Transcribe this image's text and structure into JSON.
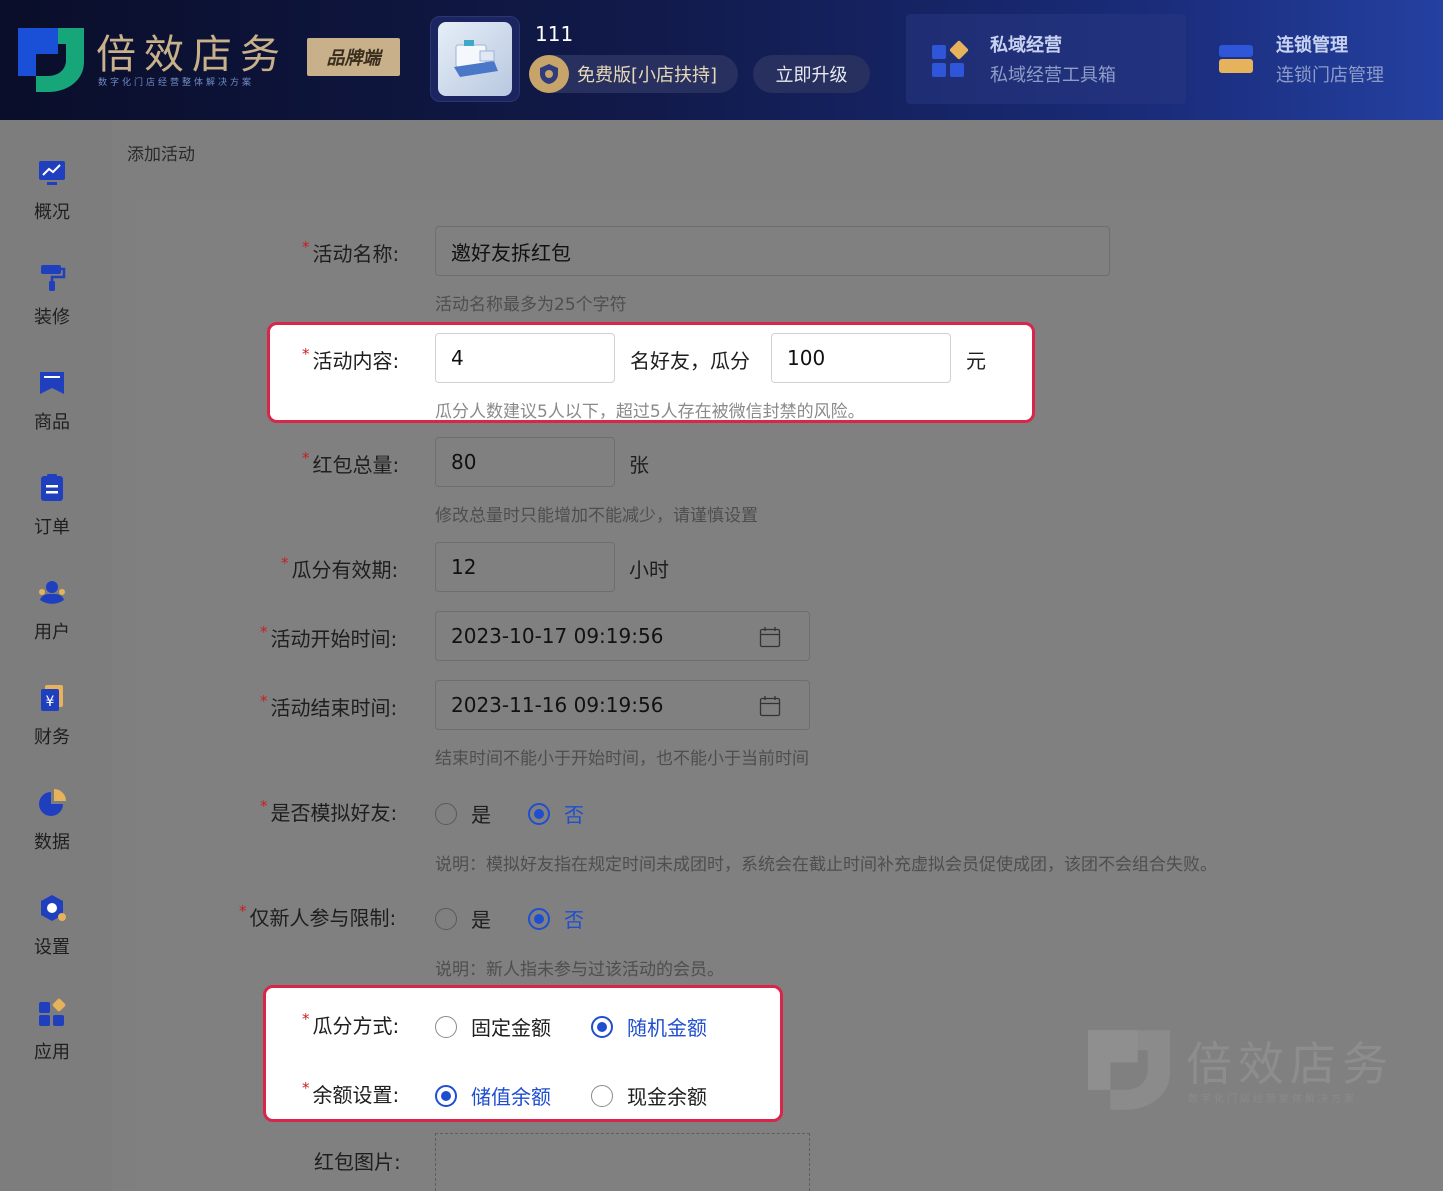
{
  "header": {
    "logo_text": "倍效店务",
    "logo_sub": "数字化门店经营整体解决方案",
    "brand_badge": "品牌端",
    "store_name": "111",
    "plan_label": "免费版[小店扶持]",
    "upgrade_label": "立即升级",
    "tools": [
      {
        "title": "私域经营",
        "subtitle": "私域经营工具箱",
        "icon": "grid-diamond-icon"
      },
      {
        "title": "连锁管理",
        "subtitle": "连锁门店管理",
        "icon": "store-icon"
      }
    ]
  },
  "sidebar": {
    "items": [
      {
        "label": "概况",
        "icon": "chart-monitor-icon"
      },
      {
        "label": "装修",
        "icon": "paint-roller-icon"
      },
      {
        "label": "商品",
        "icon": "product-tag-icon"
      },
      {
        "label": "订单",
        "icon": "clipboard-icon"
      },
      {
        "label": "用户",
        "icon": "users-icon"
      },
      {
        "label": "财务",
        "icon": "yuan-wallet-icon"
      },
      {
        "label": "数据",
        "icon": "pie-chart-icon"
      },
      {
        "label": "设置",
        "icon": "gear-hex-icon"
      },
      {
        "label": "应用",
        "icon": "apps-grid-icon"
      }
    ]
  },
  "breadcrumb": "添加活动",
  "form": {
    "name": {
      "label": "活动名称:",
      "value": "邀好友拆红包",
      "hint": "活动名称最多为25个字符"
    },
    "content": {
      "label": "活动内容:",
      "friends": "4",
      "mid_text": "名好友，瓜分",
      "amount": "100",
      "unit": "元",
      "hint": "瓜分人数建议5人以下，超过5人存在被微信封禁的风险。"
    },
    "total": {
      "label": "红包总量:",
      "value": "80",
      "unit": "张",
      "hint": "修改总量时只能增加不能减少，请谨慎设置"
    },
    "validity": {
      "label": "瓜分有效期:",
      "value": "12",
      "unit": "小时"
    },
    "start_time": {
      "label": "活动开始时间:",
      "value": "2023-10-17 09:19:56"
    },
    "end_time": {
      "label": "活动结束时间:",
      "value": "2023-11-16 09:19:56",
      "hint": "结束时间不能小于开始时间，也不能小于当前时间"
    },
    "simulate": {
      "label": "是否模拟好友:",
      "options": [
        "是",
        "否"
      ],
      "selected": "否",
      "hint": "说明：模拟好友指在规定时间未成团时，系统会在截止时间补充虚拟会员促使成团，该团不会组合失败。"
    },
    "newbie": {
      "label": "仅新人参与限制:",
      "options": [
        "是",
        "否"
      ],
      "selected": "否",
      "hint": "说明：新人指未参与过该活动的会员。"
    },
    "split_mode": {
      "label": "瓜分方式:",
      "options": [
        "固定金额",
        "随机金额"
      ],
      "selected": "随机金额"
    },
    "balance": {
      "label": "余额设置:",
      "options": [
        "储值余额",
        "现金余额"
      ],
      "selected": "储值余额"
    },
    "image": {
      "label": "红包图片:"
    }
  },
  "watermark": {
    "text": "倍效店务",
    "sub": "数字化门店经营整体解决方案"
  },
  "colors": {
    "accent": "#1f4fd0",
    "highlight_border": "#d7264a",
    "required": "#c81e1e",
    "gold": "#c7b08a"
  }
}
